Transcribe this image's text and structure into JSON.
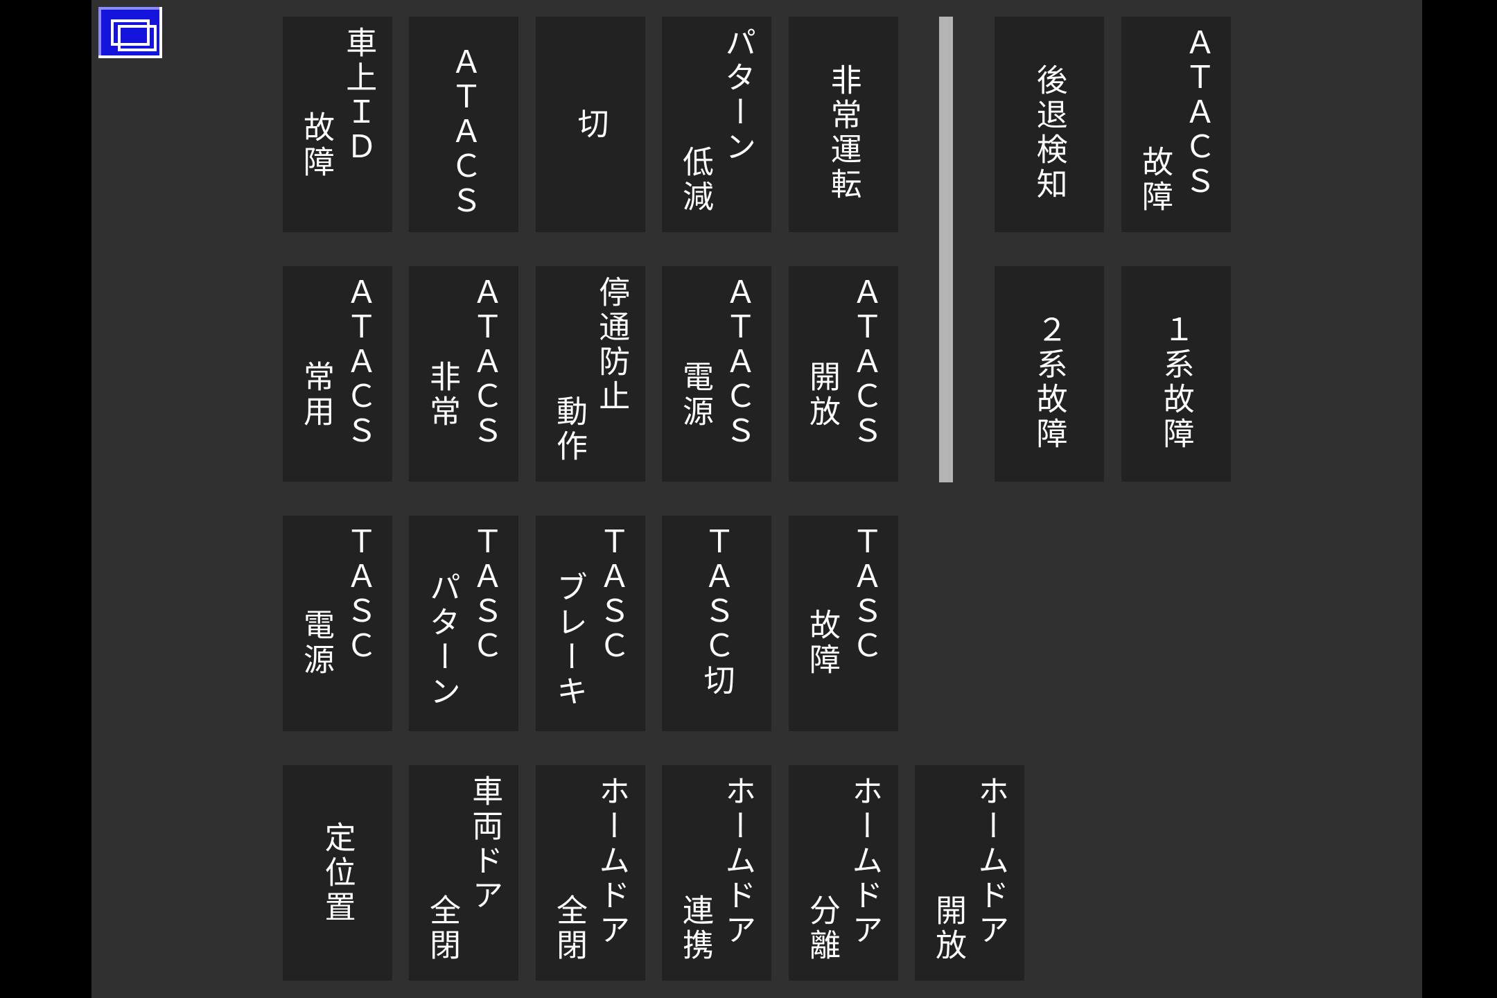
{
  "colors": {
    "background": "#303030",
    "outer": "#000000",
    "button_bg": "#222222",
    "button_text": "#ffffff",
    "divider": "#b4b4b4",
    "icon_bg": "#1414dc"
  },
  "window_icon": {
    "name": "window-restore-icon"
  },
  "rows": [
    {
      "buttons": [
        {
          "id": "vehicle-id-fault",
          "lines": [
            "車上ＩＤ",
            "故障"
          ]
        },
        {
          "id": "atacs",
          "lines": [
            "ＡＴＡＣＳ"
          ]
        },
        {
          "id": "cut",
          "lines": [
            "切"
          ]
        },
        {
          "id": "pattern-reduction",
          "lines": [
            "パターン",
            "低減"
          ]
        },
        {
          "id": "emergency-operation",
          "lines": [
            "非常運転"
          ]
        },
        {
          "id": "reverse-detection",
          "lines": [
            "後退検知"
          ]
        },
        {
          "id": "atacs-fault",
          "lines": [
            "ＡＴＡＣＳ",
            "故障"
          ]
        }
      ]
    },
    {
      "buttons": [
        {
          "id": "atacs-service",
          "lines": [
            "ＡＴＡＣＳ",
            "常用"
          ]
        },
        {
          "id": "atacs-emergency",
          "lines": [
            "ＡＴＡＣＳ",
            "非常"
          ]
        },
        {
          "id": "stop-pass-prevention",
          "lines": [
            "停通防止",
            "動作"
          ]
        },
        {
          "id": "atacs-power",
          "lines": [
            "ＡＴＡＣＳ",
            "電源"
          ]
        },
        {
          "id": "atacs-open",
          "lines": [
            "ＡＴＡＣＳ",
            "開放"
          ]
        },
        {
          "id": "system2-fault",
          "lines": [
            "２系故障"
          ]
        },
        {
          "id": "system1-fault",
          "lines": [
            "１系故障"
          ]
        }
      ]
    },
    {
      "buttons": [
        {
          "id": "tasc-power",
          "lines": [
            "ＴＡＳＣ",
            "電源"
          ]
        },
        {
          "id": "tasc-pattern",
          "lines": [
            "ＴＡＳＣ",
            "パターン"
          ]
        },
        {
          "id": "tasc-brake",
          "lines": [
            "ＴＡＳＣ",
            "ブレーキ"
          ]
        },
        {
          "id": "tasc-cut",
          "lines": [
            "ＴＡＳＣ切"
          ]
        },
        {
          "id": "tasc-fault",
          "lines": [
            "ＴＡＳＣ",
            "故障"
          ]
        }
      ]
    },
    {
      "buttons": [
        {
          "id": "fixed-position",
          "lines": [
            "定位置"
          ]
        },
        {
          "id": "vehicle-door-all-closed",
          "lines": [
            "車両ドア",
            "全閉"
          ]
        },
        {
          "id": "platform-door-all-closed",
          "lines": [
            "ホームドア",
            "全閉"
          ]
        },
        {
          "id": "platform-door-linked",
          "lines": [
            "ホームドア",
            "連携"
          ]
        },
        {
          "id": "platform-door-separated",
          "lines": [
            "ホームドア",
            "分離"
          ]
        },
        {
          "id": "platform-door-open",
          "lines": [
            "ホームドア",
            "開放"
          ]
        }
      ]
    }
  ]
}
